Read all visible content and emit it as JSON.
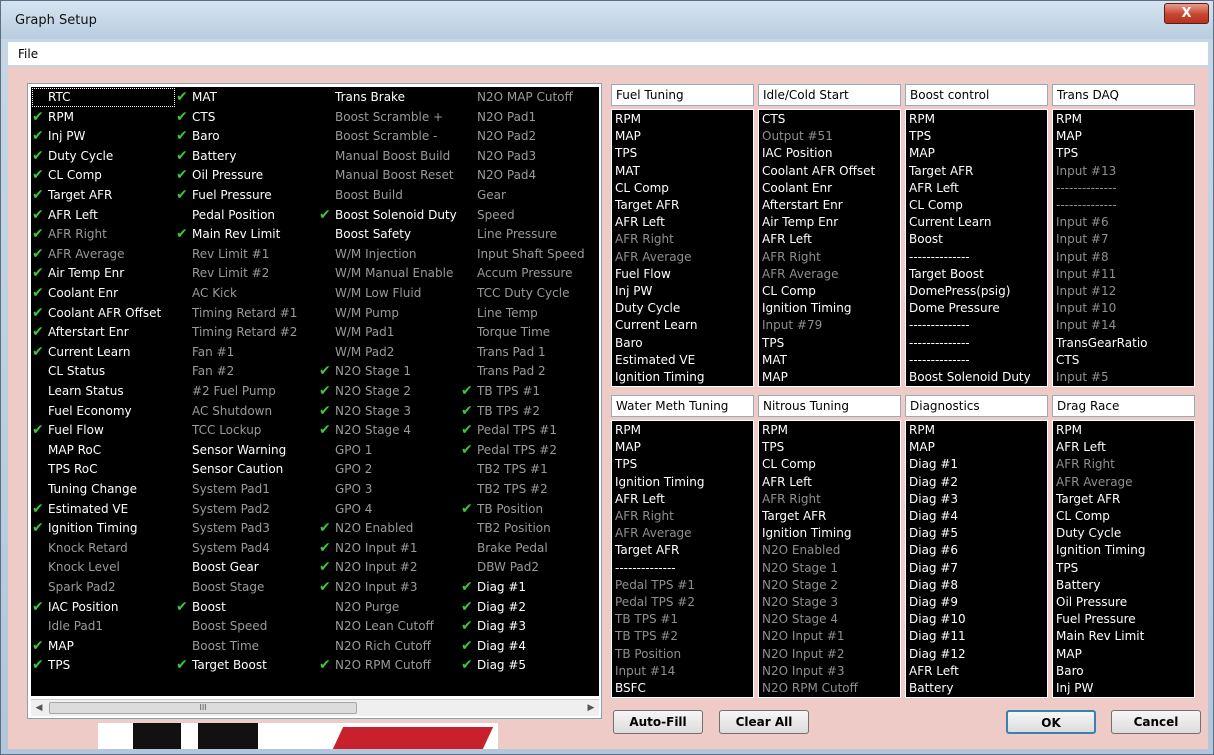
{
  "window": {
    "title": "Graph Setup",
    "close_glyph": "X"
  },
  "menu": {
    "file": "File"
  },
  "picker": {
    "columns": [
      [
        [
          "RTC",
          0,
          1
        ],
        [
          "RPM",
          1,
          1
        ],
        [
          "Inj PW",
          1,
          1
        ],
        [
          "Duty Cycle",
          1,
          1
        ],
        [
          "CL Comp",
          1,
          1
        ],
        [
          "Target AFR",
          1,
          1
        ],
        [
          "AFR Left",
          1,
          1
        ],
        [
          "AFR Right",
          1,
          0
        ],
        [
          "AFR Average",
          1,
          0
        ],
        [
          "Air Temp Enr",
          1,
          1
        ],
        [
          "Coolant Enr",
          1,
          1
        ],
        [
          "Coolant AFR Offset",
          1,
          1
        ],
        [
          "Afterstart Enr",
          1,
          1
        ],
        [
          "Current Learn",
          1,
          1
        ],
        [
          "CL Status",
          0,
          1
        ],
        [
          "Learn Status",
          0,
          1
        ],
        [
          "Fuel Economy",
          0,
          1
        ],
        [
          "Fuel Flow",
          1,
          1
        ],
        [
          "MAP RoC",
          0,
          1
        ],
        [
          "TPS RoC",
          0,
          1
        ],
        [
          "Tuning Change",
          0,
          1
        ],
        [
          "Estimated VE",
          1,
          1
        ],
        [
          "Ignition Timing",
          1,
          1
        ],
        [
          "Knock Retard",
          0,
          0
        ],
        [
          "Knock Level",
          0,
          0
        ],
        [
          "Spark Pad2",
          0,
          0
        ],
        [
          "IAC Position",
          1,
          1
        ],
        [
          "Idle Pad1",
          0,
          0
        ],
        [
          "MAP",
          1,
          1
        ],
        [
          "TPS",
          1,
          1
        ]
      ],
      [
        [
          "MAT",
          1,
          1
        ],
        [
          "CTS",
          1,
          1
        ],
        [
          "Baro",
          1,
          1
        ],
        [
          "Battery",
          1,
          1
        ],
        [
          "Oil Pressure",
          1,
          1
        ],
        [
          "Fuel Pressure",
          1,
          1
        ],
        [
          "Pedal Position",
          0,
          1
        ],
        [
          "Main Rev Limit",
          1,
          1
        ],
        [
          "Rev Limit #1",
          0,
          0
        ],
        [
          "Rev Limit #2",
          0,
          0
        ],
        [
          "AC Kick",
          0,
          0
        ],
        [
          "Timing Retard #1",
          0,
          0
        ],
        [
          "Timing Retard #2",
          0,
          0
        ],
        [
          "Fan #1",
          0,
          0
        ],
        [
          "Fan #2",
          0,
          0
        ],
        [
          "#2 Fuel Pump",
          0,
          0
        ],
        [
          "AC Shutdown",
          0,
          0
        ],
        [
          "TCC Lockup",
          0,
          0
        ],
        [
          "Sensor Warning",
          0,
          1
        ],
        [
          "Sensor Caution",
          0,
          1
        ],
        [
          "System Pad1",
          0,
          0
        ],
        [
          "System Pad2",
          0,
          0
        ],
        [
          "System Pad3",
          0,
          0
        ],
        [
          "System Pad4",
          0,
          0
        ],
        [
          "Boost Gear",
          0,
          1
        ],
        [
          "Boost Stage",
          0,
          0
        ],
        [
          "Boost",
          1,
          1
        ],
        [
          "Boost Speed",
          0,
          0
        ],
        [
          "Boost Time",
          0,
          0
        ],
        [
          "Target Boost",
          1,
          1
        ]
      ],
      [
        [
          "Trans Brake",
          0,
          1
        ],
        [
          "Boost Scramble +",
          0,
          0
        ],
        [
          "Boost Scramble -",
          0,
          0
        ],
        [
          "Manual Boost Build",
          0,
          0
        ],
        [
          "Manual Boost Reset",
          0,
          0
        ],
        [
          "Boost Build",
          0,
          0
        ],
        [
          "Boost Solenoid Duty",
          1,
          1
        ],
        [
          "Boost Safety",
          0,
          1
        ],
        [
          "W/M Injection",
          0,
          0
        ],
        [
          "W/M Manual Enable",
          0,
          0
        ],
        [
          "W/M Low Fluid",
          0,
          0
        ],
        [
          "W/M Pump",
          0,
          0
        ],
        [
          "W/M Pad1",
          0,
          0
        ],
        [
          "W/M Pad2",
          0,
          0
        ],
        [
          "N2O Stage 1",
          1,
          0
        ],
        [
          "N2O Stage 2",
          1,
          0
        ],
        [
          "N2O Stage 3",
          1,
          0
        ],
        [
          "N2O Stage 4",
          1,
          0
        ],
        [
          "GPO 1",
          0,
          0
        ],
        [
          "GPO 2",
          0,
          0
        ],
        [
          "GPO 3",
          0,
          0
        ],
        [
          "GPO 4",
          0,
          0
        ],
        [
          "N2O Enabled",
          1,
          0
        ],
        [
          "N2O Input #1",
          1,
          0
        ],
        [
          "N2O Input #2",
          1,
          0
        ],
        [
          "N2O Input #3",
          1,
          0
        ],
        [
          "N2O Purge",
          0,
          0
        ],
        [
          "N2O Lean Cutoff",
          0,
          0
        ],
        [
          "N2O Rich Cutoff",
          0,
          0
        ],
        [
          "N2O RPM Cutoff",
          1,
          0
        ]
      ],
      [
        [
          "N2O MAP Cutoff",
          0,
          0
        ],
        [
          "N2O Pad1",
          0,
          0
        ],
        [
          "N2O Pad2",
          0,
          0
        ],
        [
          "N2O Pad3",
          0,
          0
        ],
        [
          "N2O Pad4",
          0,
          0
        ],
        [
          "Gear",
          0,
          0
        ],
        [
          "Speed",
          0,
          0
        ],
        [
          "Line Pressure",
          0,
          0
        ],
        [
          "Input Shaft Speed",
          0,
          0
        ],
        [
          "Accum Pressure",
          0,
          0
        ],
        [
          "TCC Duty Cycle",
          0,
          0
        ],
        [
          "Line Temp",
          0,
          0
        ],
        [
          "Torque Time",
          0,
          0
        ],
        [
          "Trans Pad 1",
          0,
          0
        ],
        [
          "Trans Pad 2",
          0,
          0
        ],
        [
          "TB TPS #1",
          1,
          0
        ],
        [
          "TB TPS #2",
          1,
          0
        ],
        [
          "Pedal TPS #1",
          1,
          0
        ],
        [
          "Pedal TPS #2",
          1,
          0
        ],
        [
          "TB2 TPS #1",
          0,
          0
        ],
        [
          "TB2 TPS #2",
          0,
          0
        ],
        [
          "TB Position",
          1,
          0
        ],
        [
          "TB2 Position",
          0,
          0
        ],
        [
          "Brake Pedal",
          0,
          0
        ],
        [
          "DBW Pad2",
          0,
          0
        ],
        [
          "Diag #1",
          1,
          1
        ],
        [
          "Diag #2",
          1,
          1
        ],
        [
          "Diag #3",
          1,
          1
        ],
        [
          "Diag #4",
          1,
          1
        ],
        [
          "Diag #5",
          1,
          1
        ]
      ]
    ],
    "scroll_thumb": "III",
    "scroll_left": "◀",
    "scroll_right": "▶"
  },
  "groups": [
    {
      "title": "Fuel Tuning",
      "items": [
        [
          "RPM",
          1
        ],
        [
          "MAP",
          1
        ],
        [
          "TPS",
          1
        ],
        [
          "MAT",
          1
        ],
        [
          "CL Comp",
          1
        ],
        [
          "Target AFR",
          1
        ],
        [
          "AFR Left",
          1
        ],
        [
          "AFR Right",
          0
        ],
        [
          "AFR Average",
          0
        ],
        [
          "Fuel Flow",
          1
        ],
        [
          "Inj PW",
          1
        ],
        [
          "Duty Cycle",
          1
        ],
        [
          "Current Learn",
          1
        ],
        [
          "Baro",
          1
        ],
        [
          "Estimated VE",
          1
        ],
        [
          "Ignition Timing",
          1
        ]
      ]
    },
    {
      "title": "Idle/Cold Start",
      "items": [
        [
          "CTS",
          1
        ],
        [
          "Output #51",
          0
        ],
        [
          "IAC Position",
          1
        ],
        [
          "Coolant AFR Offset",
          1
        ],
        [
          "Coolant Enr",
          1
        ],
        [
          "Afterstart Enr",
          1
        ],
        [
          "Air Temp Enr",
          1
        ],
        [
          "AFR Left",
          1
        ],
        [
          "AFR Right",
          0
        ],
        [
          "AFR Average",
          0
        ],
        [
          "CL Comp",
          1
        ],
        [
          "Ignition Timing",
          1
        ],
        [
          "Input #79",
          0
        ],
        [
          "TPS",
          1
        ],
        [
          "MAT",
          1
        ],
        [
          "MAP",
          1
        ]
      ]
    },
    {
      "title": "Boost control",
      "items": [
        [
          "RPM",
          1
        ],
        [
          "TPS",
          1
        ],
        [
          "MAP",
          1
        ],
        [
          "Target AFR",
          1
        ],
        [
          "AFR Left",
          1
        ],
        [
          "CL Comp",
          1
        ],
        [
          "Current Learn",
          1
        ],
        [
          "Boost",
          1
        ],
        [
          "--------------",
          1
        ],
        [
          "Target Boost",
          1
        ],
        [
          "DomePress(psig)",
          1
        ],
        [
          "Dome Pressure",
          1
        ],
        [
          "--------------",
          1
        ],
        [
          "--------------",
          1
        ],
        [
          "--------------",
          1
        ],
        [
          "Boost Solenoid Duty",
          1
        ]
      ]
    },
    {
      "title": "Trans DAQ",
      "items": [
        [
          "RPM",
          1
        ],
        [
          "MAP",
          1
        ],
        [
          "TPS",
          1
        ],
        [
          "Input #13",
          0
        ],
        [
          "--------------",
          0
        ],
        [
          "--------------",
          0
        ],
        [
          "Input #6",
          0
        ],
        [
          "Input #7",
          0
        ],
        [
          "Input #8",
          0
        ],
        [
          "Input #11",
          0
        ],
        [
          "Input #12",
          0
        ],
        [
          "Input #10",
          0
        ],
        [
          "Input #14",
          0
        ],
        [
          "TransGearRatio",
          1
        ],
        [
          "CTS",
          1
        ],
        [
          "Input #5",
          0
        ]
      ]
    },
    {
      "title": "Water Meth Tuning",
      "items": [
        [
          "RPM",
          1
        ],
        [
          "MAP",
          1
        ],
        [
          "TPS",
          1
        ],
        [
          "Ignition Timing",
          1
        ],
        [
          "AFR Left",
          1
        ],
        [
          "AFR Right",
          0
        ],
        [
          "AFR Average",
          0
        ],
        [
          "Target AFR",
          1
        ],
        [
          "--------------",
          1
        ],
        [
          "Pedal TPS #1",
          0
        ],
        [
          "Pedal TPS #2",
          0
        ],
        [
          "TB TPS #1",
          0
        ],
        [
          "TB TPS #2",
          0
        ],
        [
          "TB Position",
          0
        ],
        [
          "Input #14",
          0
        ],
        [
          "BSFC",
          1
        ]
      ]
    },
    {
      "title": "Nitrous Tuning",
      "items": [
        [
          "RPM",
          1
        ],
        [
          "TPS",
          1
        ],
        [
          "CL Comp",
          1
        ],
        [
          "AFR Left",
          1
        ],
        [
          "AFR Right",
          0
        ],
        [
          "Target AFR",
          1
        ],
        [
          "Ignition Timing",
          1
        ],
        [
          "N2O Enabled",
          0
        ],
        [
          "N2O Stage 1",
          0
        ],
        [
          "N2O Stage 2",
          0
        ],
        [
          "N2O Stage 3",
          0
        ],
        [
          "N2O Stage 4",
          0
        ],
        [
          "N2O Input #1",
          0
        ],
        [
          "N2O Input #2",
          0
        ],
        [
          "N2O Input #3",
          0
        ],
        [
          "N2O RPM Cutoff",
          0
        ]
      ]
    },
    {
      "title": "Diagnostics",
      "items": [
        [
          "RPM",
          1
        ],
        [
          "MAP",
          1
        ],
        [
          "Diag #1",
          1
        ],
        [
          "Diag #2",
          1
        ],
        [
          "Diag #3",
          1
        ],
        [
          "Diag #4",
          1
        ],
        [
          "Diag #5",
          1
        ],
        [
          "Diag #6",
          1
        ],
        [
          "Diag #7",
          1
        ],
        [
          "Diag #8",
          1
        ],
        [
          "Diag #9",
          1
        ],
        [
          "Diag #10",
          1
        ],
        [
          "Diag #11",
          1
        ],
        [
          "Diag #12",
          1
        ],
        [
          "AFR Left",
          1
        ],
        [
          "Battery",
          1
        ]
      ]
    },
    {
      "title": "Drag Race",
      "items": [
        [
          "RPM",
          1
        ],
        [
          "AFR Left",
          1
        ],
        [
          "AFR Right",
          0
        ],
        [
          "AFR Average",
          0
        ],
        [
          "Target AFR",
          1
        ],
        [
          "CL Comp",
          1
        ],
        [
          "Duty Cycle",
          1
        ],
        [
          "Ignition Timing",
          1
        ],
        [
          "TPS",
          1
        ],
        [
          "Battery",
          1
        ],
        [
          "Oil Pressure",
          1
        ],
        [
          "Fuel Pressure",
          1
        ],
        [
          "Main Rev Limit",
          1
        ],
        [
          "MAP",
          1
        ],
        [
          "Baro",
          1
        ],
        [
          "Inj PW",
          1
        ]
      ]
    }
  ],
  "buttons": {
    "autofill": "Auto-Fill",
    "clearall": "Clear All",
    "ok": "OK",
    "cancel": "Cancel"
  },
  "colors": {
    "checked": "#3ec43e",
    "active_text": "#ffffff",
    "inactive_text": "#9a9a9a"
  }
}
